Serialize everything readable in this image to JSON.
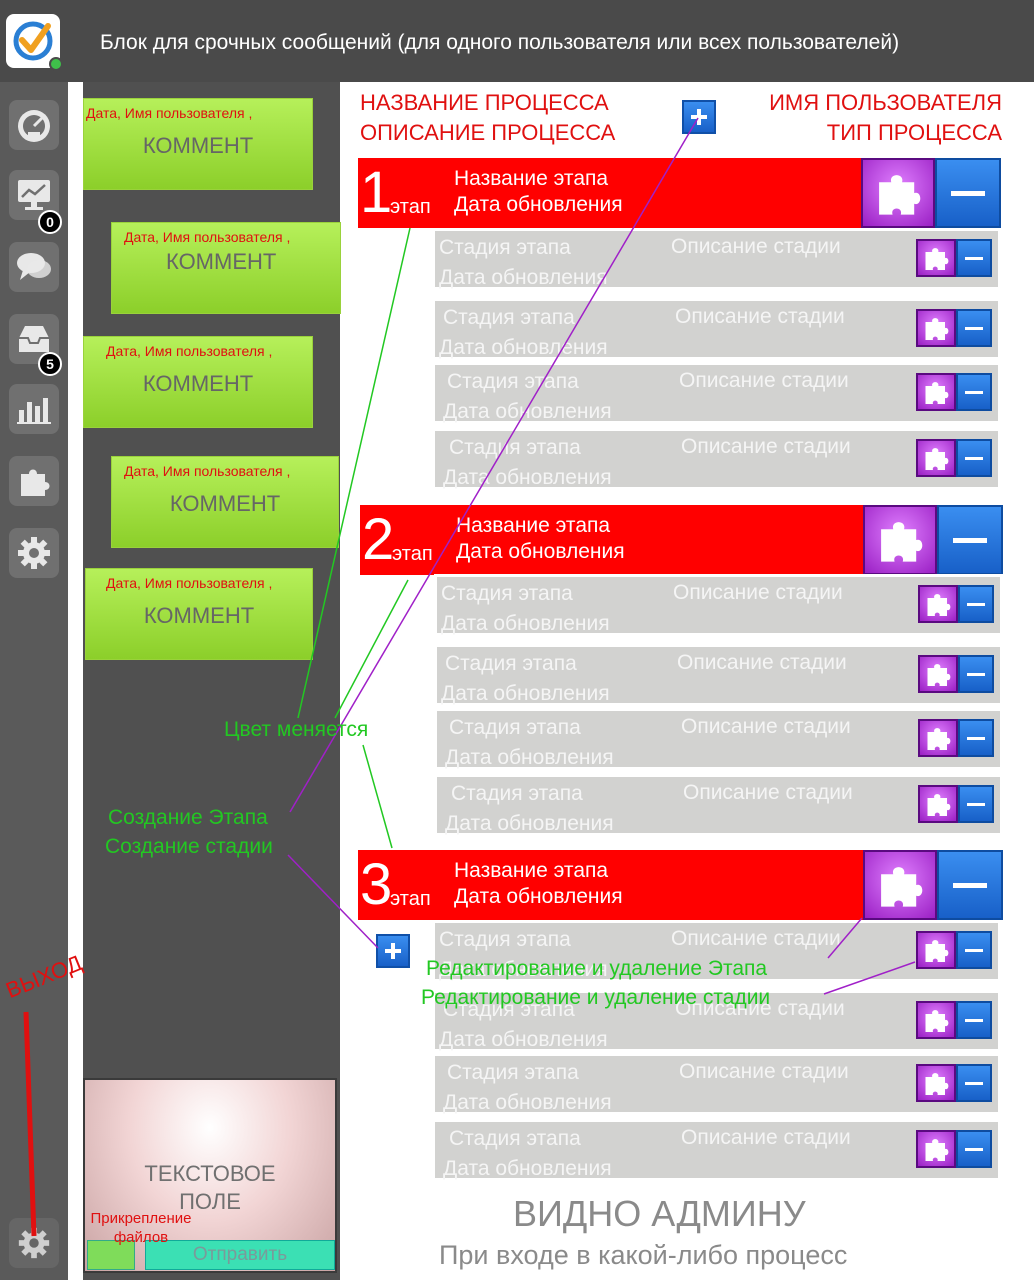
{
  "header": {
    "title": "Блок для срочных сообщений (для одного пользователя или всех пользователей)"
  },
  "sidebar": {
    "items": [
      {
        "icon": "dashboard-icon"
      },
      {
        "icon": "monitor-chart-icon",
        "badge": "0"
      },
      {
        "icon": "chat-icon"
      },
      {
        "icon": "inbox-icon",
        "badge": "5"
      },
      {
        "icon": "bar-chart-icon"
      },
      {
        "icon": "puzzle-icon"
      },
      {
        "icon": "gear-icon"
      }
    ],
    "exit_icon": "gear-icon",
    "exit_label": "ВЫХОД"
  },
  "messages": {
    "comments": [
      {
        "meta": "Дата, Имя пользователя ,",
        "text": "КОММЕНТ"
      },
      {
        "meta": "Дата, Имя пользователя ,",
        "text": "КОММЕНТ"
      },
      {
        "meta": "Дата, Имя пользователя ,",
        "text": "КОММЕНТ"
      },
      {
        "meta": "Дата, Имя пользователя ,",
        "text": "КОММЕНТ"
      },
      {
        "meta": "Дата, Имя пользователя ,",
        "text": "КОММЕНТ"
      }
    ],
    "textbox_line1": "ТЕКСТОВОЕ",
    "textbox_line2": "ПОЛЕ",
    "attach_line1": "Прикрепление",
    "attach_line2": "файлов",
    "send_label": "Отправить"
  },
  "process": {
    "name": "НАЗВАНИЕ ПРОЦЕССА",
    "description": "ОПИСАНИЕ ПРОЦЕССА",
    "user_name": "ИМЯ ПОЛЬЗОВАТЕЛЯ",
    "process_type": "ТИП ПРОЦЕССА",
    "stages": [
      {
        "number": "1",
        "etap": "этап",
        "name": "Название этапа",
        "date": "Дата обновления",
        "substages": [
          {
            "name": "Стадия этапа",
            "date": "Дата обновления",
            "desc": "Описание стадии"
          },
          {
            "name": "Стадия этапа",
            "date": "Дата обновления",
            "desc": "Описание стадии"
          },
          {
            "name": "Стадия этапа",
            "date": "Дата обновления",
            "desc": "Описание стадии"
          },
          {
            "name": "Стадия этапа",
            "date": "Дата обновления",
            "desc": "Описание стадии"
          }
        ]
      },
      {
        "number": "2",
        "etap": "этап",
        "name": "Название этапа",
        "date": "Дата обновления",
        "substages": [
          {
            "name": "Стадия этапа",
            "date": "Дата обновления",
            "desc": "Описание стадии"
          },
          {
            "name": "Стадия этапа",
            "date": "Дата обновления",
            "desc": "Описание стадии"
          },
          {
            "name": "Стадия этапа",
            "date": "Дата обновления",
            "desc": "Описание стадии"
          },
          {
            "name": "Стадия этапа",
            "date": "Дата обновления",
            "desc": "Описание стадии"
          }
        ]
      },
      {
        "number": "3",
        "etap": "этап",
        "name": "Название этапа",
        "date": "Дата обновления",
        "substages": [
          {
            "name": "Стадия этапа",
            "date": "Дата обновления",
            "desc": "Описание стадии"
          },
          {
            "name": "Стадия этапа",
            "date": "Дата обновления",
            "desc": "Описание стадии"
          },
          {
            "name": "Стадия этапа",
            "date": "Дата обновления",
            "desc": "Описание стадии"
          },
          {
            "name": "Стадия этапа",
            "date": "Дата обновления",
            "desc": "Описание стадии"
          }
        ]
      }
    ]
  },
  "annotations": {
    "color_changes": "Цвет меняется",
    "create_stage": "Создание Этапа",
    "create_substage": "Создание стадии",
    "edit_stage": "Редактирование и удаление Этапа",
    "edit_substage": "Редактирование и удаление стадии",
    "admin_visible": "ВИДНО АДМИНУ",
    "on_enter": "При входе в какой-либо процесс"
  },
  "colors": {
    "stage_red": "#ff0000",
    "comment_green": "#a4e44a",
    "annotation_green": "#22c822",
    "annotation_red": "#e01010",
    "edit_purple": "#b030d8",
    "delete_blue": "#1f6fd8"
  }
}
